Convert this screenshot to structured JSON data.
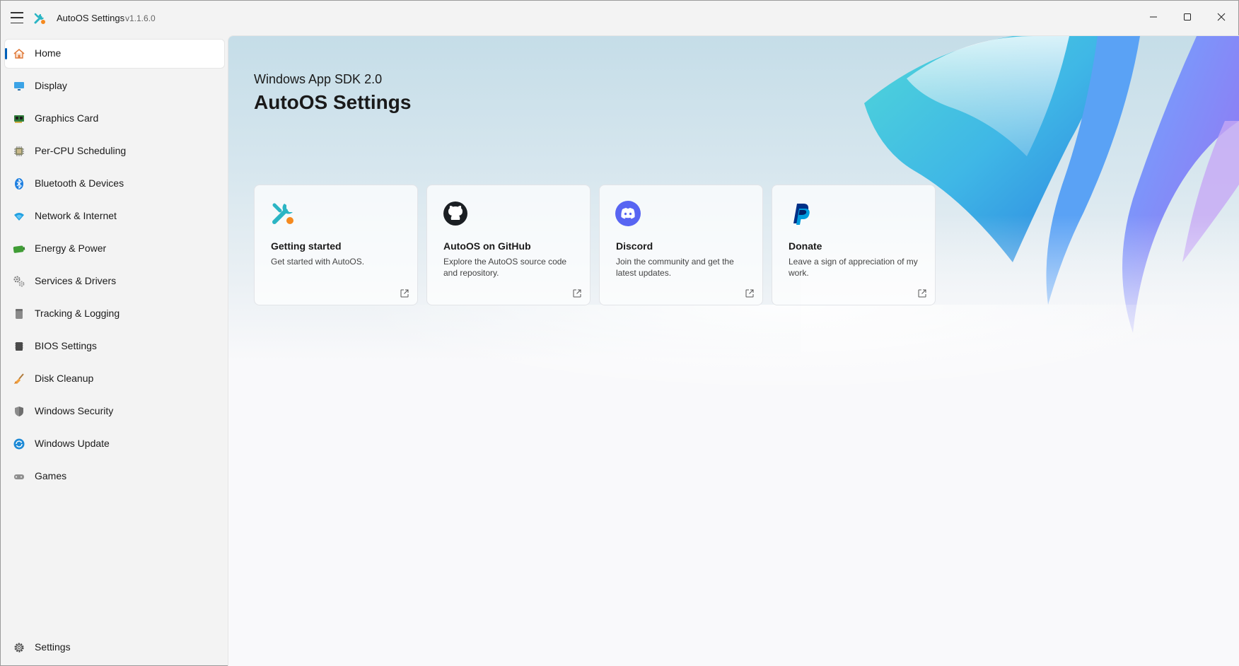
{
  "titlebar": {
    "app_name": "AutoOS Settings",
    "version": "v1.1.6.0",
    "menu_icon": "hamburger-icon",
    "controls": [
      "minimize-icon",
      "maximize-icon",
      "close-icon"
    ]
  },
  "sidebar": {
    "items": [
      {
        "label": "Home",
        "icon": "home-icon",
        "selected": true
      },
      {
        "label": "Display",
        "icon": "monitor-icon"
      },
      {
        "label": "Graphics Card",
        "icon": "gpu-icon"
      },
      {
        "label": "Per-CPU Scheduling",
        "icon": "cpu-chip-icon"
      },
      {
        "label": "Bluetooth & Devices",
        "icon": "bluetooth-icon"
      },
      {
        "label": "Network & Internet",
        "icon": "wifi-icon"
      },
      {
        "label": "Energy & Power",
        "icon": "battery-icon"
      },
      {
        "label": "Services & Drivers",
        "icon": "gears-icon"
      },
      {
        "label": "Tracking & Logging",
        "icon": "document-icon"
      },
      {
        "label": "BIOS Settings",
        "icon": "bios-chip-icon"
      },
      {
        "label": "Disk Cleanup",
        "icon": "broom-icon"
      },
      {
        "label": "Windows Security",
        "icon": "shield-icon"
      },
      {
        "label": "Windows Update",
        "icon": "update-icon"
      },
      {
        "label": "Games",
        "icon": "gamepad-icon"
      }
    ],
    "footer": {
      "label": "Settings",
      "icon": "gear-icon"
    }
  },
  "hero": {
    "subtitle": "Windows App SDK 2.0",
    "title": "AutoOS Settings"
  },
  "cards": [
    {
      "title": "Getting started",
      "description": "Get started with AutoOS.",
      "icon": "autoos-logo-icon"
    },
    {
      "title": "AutoOS on GitHub",
      "description": "Explore the AutoOS source code and repository.",
      "icon": "github-icon"
    },
    {
      "title": "Discord",
      "description": "Join the community and get the latest updates.",
      "icon": "discord-icon"
    },
    {
      "title": "Donate",
      "description": "Leave a sign of appreciation of my work.",
      "icon": "paypal-icon"
    }
  ],
  "colors": {
    "accent": "#005fb8",
    "discord": "#5865f2",
    "paypal_dark": "#003087",
    "paypal_light": "#009cde"
  }
}
